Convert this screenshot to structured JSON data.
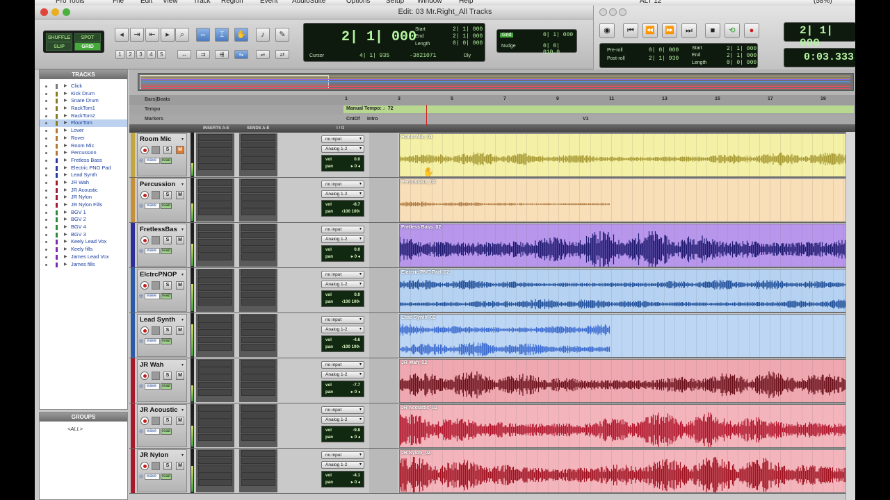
{
  "menubar": {
    "items": [
      "Pro Tools",
      "File",
      "Edit",
      "View",
      "Track",
      "Region",
      "Event",
      "AudioSuite",
      "Options",
      "Setup",
      "Window",
      "Help"
    ],
    "right": [
      "ALT 12",
      "(58%)"
    ]
  },
  "window": {
    "title": "Edit: 03 Mr.Right_All Tracks"
  },
  "modes": {
    "shuffle": "SHUFFLE",
    "spot": "SPOT",
    "slip": "SLIP",
    "grid": "GRID"
  },
  "zoom_presets": [
    "1",
    "2",
    "3",
    "4",
    "5"
  ],
  "counter": {
    "main": "2| 1| 000",
    "start_label": "Start",
    "start": "2| 1| 000",
    "end_label": "End",
    "end": "2| 1| 000",
    "length_label": "Length",
    "length": "0| 0| 000",
    "cursor_label": "Cursor",
    "cursor": "4| 1| 935",
    "cursor_sample": "-3821071",
    "dly": "Dly"
  },
  "grid": {
    "label": "Grid",
    "value": "0| 1| 000",
    "nudge_label": "Nudge",
    "nudge_value": "0| 0| 010.0"
  },
  "transport": {
    "preroll_label": "Pre-roll",
    "preroll": "0| 0| 000",
    "postroll_label": "Post-roll",
    "postroll": "2| 1| 930",
    "start_label": "Start",
    "start": "2| 1| 000",
    "end_label": "End",
    "end": "2| 1| 000",
    "length_label": "Length",
    "length": "0| 0| 000",
    "main_counter": "2| 1| 000",
    "sub_counter": "0:03.333"
  },
  "tracks_panel": {
    "title": "TRACKS",
    "items": [
      {
        "name": "Click",
        "color": "#7a7a7a"
      },
      {
        "name": "Kick Drum",
        "color": "#8a7a20"
      },
      {
        "name": "Snare Drum",
        "color": "#8a7a20"
      },
      {
        "name": "RackTom1",
        "color": "#8a7a20"
      },
      {
        "name": "RackTom2",
        "color": "#8a7a20"
      },
      {
        "name": "FloorTom",
        "color": "#8a7a20",
        "selected": true
      },
      {
        "name": "Lover",
        "color": "#b07830"
      },
      {
        "name": "Rover",
        "color": "#b07830"
      },
      {
        "name": "Room Mic",
        "color": "#b07830"
      },
      {
        "name": "Percussion",
        "color": "#b07830"
      },
      {
        "name": "Fretless Bass",
        "color": "#2a3aa0"
      },
      {
        "name": "Electric PNO Pad",
        "color": "#2a3aa0"
      },
      {
        "name": "Lead Synth",
        "color": "#2a3aa0"
      },
      {
        "name": "JR Wah",
        "color": "#a01a30"
      },
      {
        "name": "JR Acoustic",
        "color": "#a01a30"
      },
      {
        "name": "JR Nylon",
        "color": "#a01a30"
      },
      {
        "name": "JR Nylon Fills",
        "color": "#a01a30"
      },
      {
        "name": "BGV 1",
        "color": "#2a8a3a"
      },
      {
        "name": "BGV 2",
        "color": "#2a8a3a"
      },
      {
        "name": "BGV 4",
        "color": "#2a8a3a"
      },
      {
        "name": "BGV 3",
        "color": "#2a8a3a"
      },
      {
        "name": "Keely Lead Vox",
        "color": "#7a2ab0"
      },
      {
        "name": "Keely fills",
        "color": "#7a2ab0"
      },
      {
        "name": "James Lead Vox",
        "color": "#7a2ab0"
      },
      {
        "name": "James fills",
        "color": "#7a2ab0"
      }
    ]
  },
  "groups_panel": {
    "title": "GROUPS",
    "items": [
      "<ALL>"
    ]
  },
  "rulers": {
    "bars_beats": "Bars|Beats",
    "tempo": "Tempo",
    "markers": "Markers",
    "tempo_value": "Manual Tempo: ♩72",
    "marker_cntof": "CntOf",
    "marker_intro": "Intro",
    "marker_v1": "V1",
    "bars": [
      "1",
      "3",
      "5",
      "7",
      "9",
      "11",
      "13",
      "15",
      "17",
      "19"
    ]
  },
  "columns": {
    "inserts": "INSERTS A-E",
    "sends": "SENDS A-E",
    "io": "I / O"
  },
  "tracks": [
    {
      "name": "Room Mic",
      "color": "#c2a640",
      "input": "no input",
      "output": "Analog 1-2",
      "vol": "0.0",
      "pan": "▸ 0 ◂",
      "region": "Room Mic_01",
      "bg": "#f4f1a6",
      "wave": "#a89a34",
      "mute_on": true,
      "view": "wave",
      "auto": "read",
      "amp": 0.3,
      "extent": 1.0,
      "rows": 1,
      "seed": 3
    },
    {
      "name": "Percussion",
      "color": "#c6903a",
      "input": "no input",
      "output": "Analog 1-2",
      "vol": "-8.7",
      "pan": "‹100  100›",
      "region": "Percussion_02",
      "bg": "#f8dfb8",
      "wave": "#b07a40",
      "mute_on": false,
      "view": "wave",
      "auto": "read",
      "amp": 0.12,
      "extent": 0.44,
      "rows": 1,
      "seed": 7
    },
    {
      "name": "FretlessBas",
      "color": "#2e2e9a",
      "input": "no input",
      "output": "Analog 1-2",
      "vol": "0.0",
      "pan": "▸ 0 ◂",
      "region": "Fretless Bass_02",
      "bg": "#b796ec",
      "wave": "#1e1a70",
      "mute_on": false,
      "view": "wave",
      "auto": "read",
      "amp": 0.85,
      "extent": 1.0,
      "rows": 1,
      "seed": 11
    },
    {
      "name": "ElctrcPNOP",
      "color": "#2a5aa8",
      "input": "no input",
      "output": "Analog 1-2",
      "vol": "0.0",
      "pan": "‹100  100›",
      "region": "Electric PNO Pad_02",
      "bg": "#b6d2f2",
      "wave": "#1f4f9a",
      "mute_on": false,
      "view": "wave",
      "auto": "read",
      "amp": 0.5,
      "extent": 1.0,
      "rows": 2,
      "seed": 13
    },
    {
      "name": "Lead Synth",
      "color": "#2a5aa8",
      "input": "no input",
      "output": "Analog 1-2",
      "vol": "-4.6",
      "pan": "‹100  100›",
      "region": "Lead Synth_02",
      "bg": "#bcd6f4",
      "wave": "#3a6ad0",
      "mute_on": false,
      "view": "wave",
      "auto": "read",
      "amp": 0.7,
      "extent": 0.44,
      "rows": 2,
      "seed": 17
    },
    {
      "name": "JR Wah",
      "color": "#a81a2a",
      "input": "no input",
      "output": "Analog 1-2",
      "vol": "-7.7",
      "pan": "▸ 0 ◂",
      "region": "JR Wah_02",
      "bg": "#f0a8b0",
      "wave": "#6a0f1a",
      "mute_on": false,
      "view": "wave",
      "auto": "read",
      "amp": 0.6,
      "extent": 1.0,
      "rows": 1,
      "seed": 19
    },
    {
      "name": "JR Acoustic",
      "color": "#a81a2a",
      "input": "no input",
      "output": "Analog 1-2",
      "vol": "-9.8",
      "pan": "▸ 0 ◂",
      "region": "JR Acoustic_02",
      "bg": "#f4b4bc",
      "wave": "#b0142a",
      "mute_on": false,
      "view": "wave",
      "auto": "read",
      "amp": 0.8,
      "extent": 1.0,
      "rows": 1,
      "seed": 23
    },
    {
      "name": "JR Nylon",
      "color": "#a81a2a",
      "input": "no input",
      "output": "Analog 1-2",
      "vol": "-4.1",
      "pan": "▸ 0 ◂",
      "region": "JR Nylon_02",
      "bg": "#f4b4bc",
      "wave": "#a0101f",
      "mute_on": false,
      "view": "wave",
      "auto": "read",
      "amp": 0.85,
      "extent": 1.0,
      "rows": 1,
      "seed": 29
    }
  ]
}
